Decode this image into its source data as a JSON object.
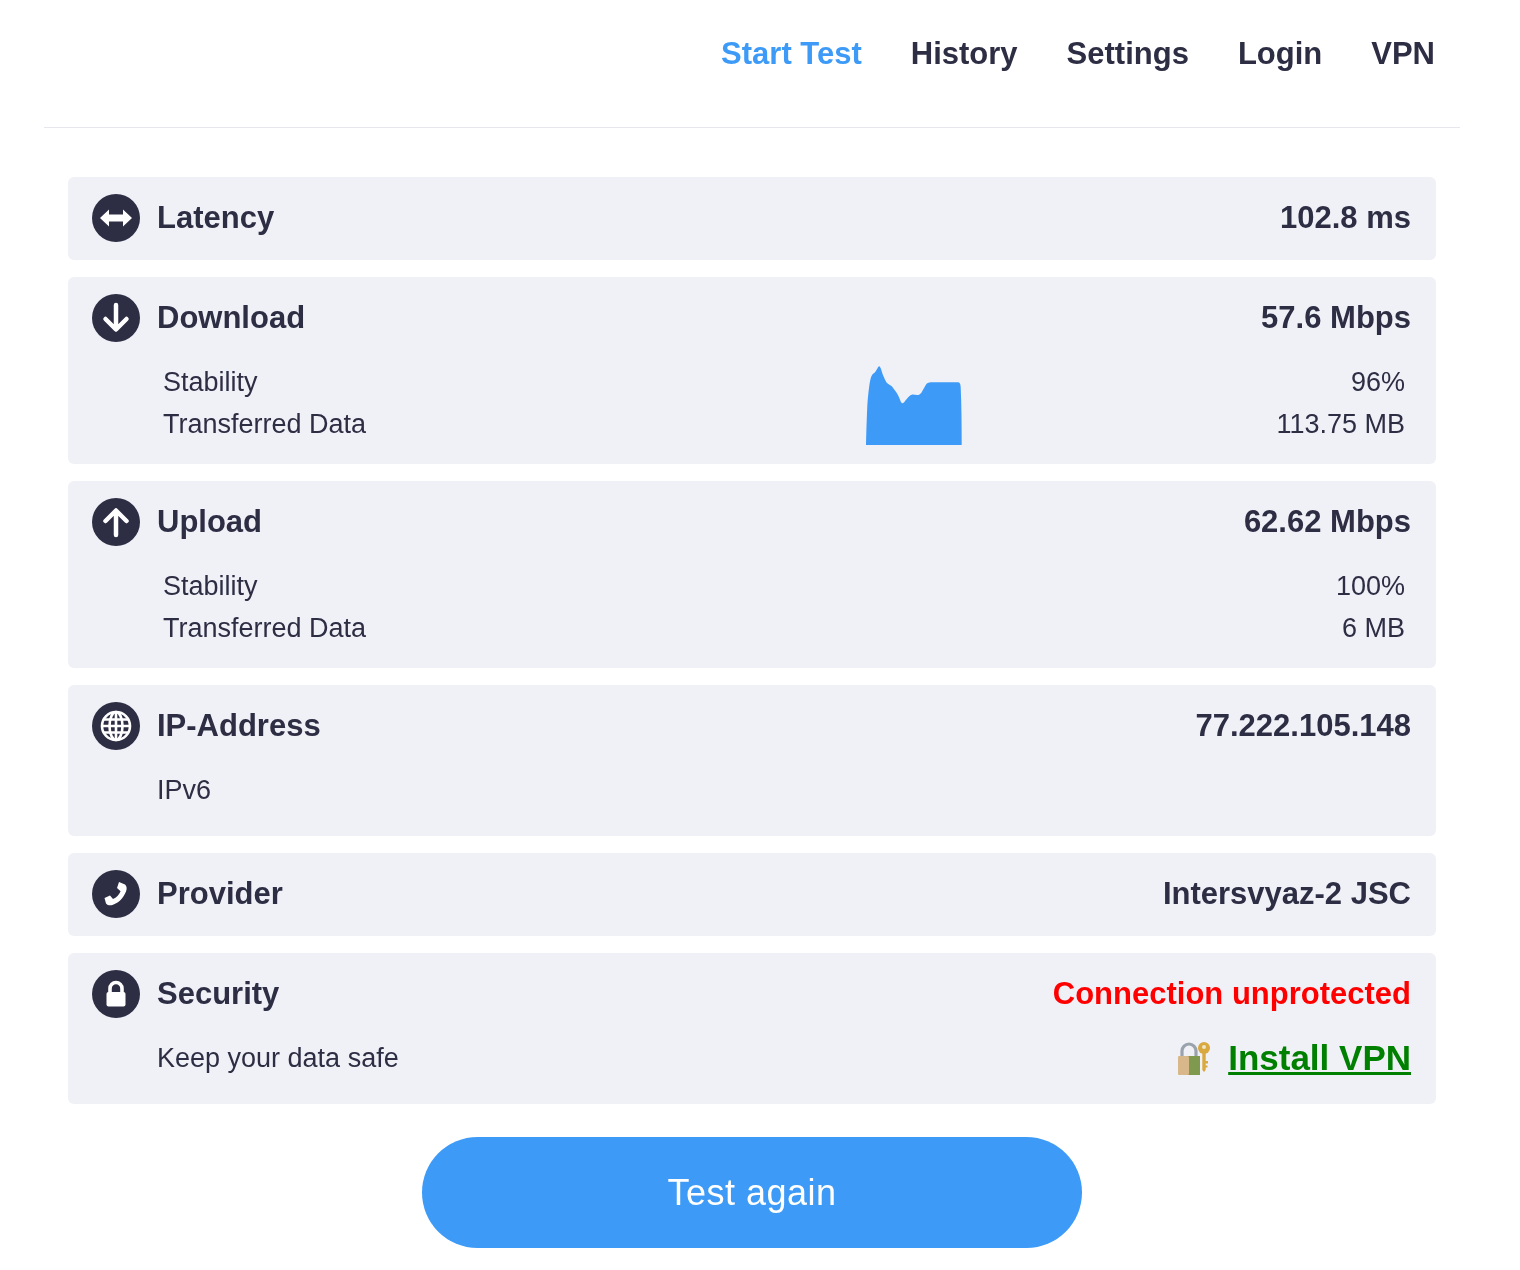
{
  "nav": [
    {
      "label": "Start Test",
      "selected": true
    },
    {
      "label": "History",
      "selected": false
    },
    {
      "label": "Settings",
      "selected": false
    },
    {
      "label": "Login",
      "selected": false
    },
    {
      "label": "VPN",
      "selected": false
    }
  ],
  "cards": [
    {
      "kind": "plain",
      "title": "Latency",
      "value": "102.8 ms",
      "warning": false
    },
    {
      "kind": "metrics",
      "title": "Download",
      "value": "57.6 Mbps",
      "warning": false,
      "graph": true,
      "rows": [
        {
          "label": "Stability",
          "value": "96%"
        },
        {
          "label": "Transferred Data",
          "value": "113.75 MB"
        }
      ]
    },
    {
      "kind": "metrics",
      "title": "Upload",
      "value": "62.62 Mbps",
      "warning": false,
      "rows": [
        {
          "label": "Stability",
          "value": "100%"
        },
        {
          "label": "Transferred Data",
          "value": "6 MB"
        }
      ]
    },
    {
      "kind": "note",
      "title": "IP-Address",
      "value": "77.222.105.148",
      "warning": false,
      "note": "IPv6"
    },
    {
      "kind": "plain",
      "title": "Provider",
      "value": "Intersvyaz-2 JSC",
      "warning": false
    },
    {
      "kind": "note",
      "title": "Security",
      "value": "Connection unprotected",
      "warning": true,
      "note": "Keep your data safe",
      "link": "Install VPN"
    }
  ],
  "action_button": "Test again"
}
